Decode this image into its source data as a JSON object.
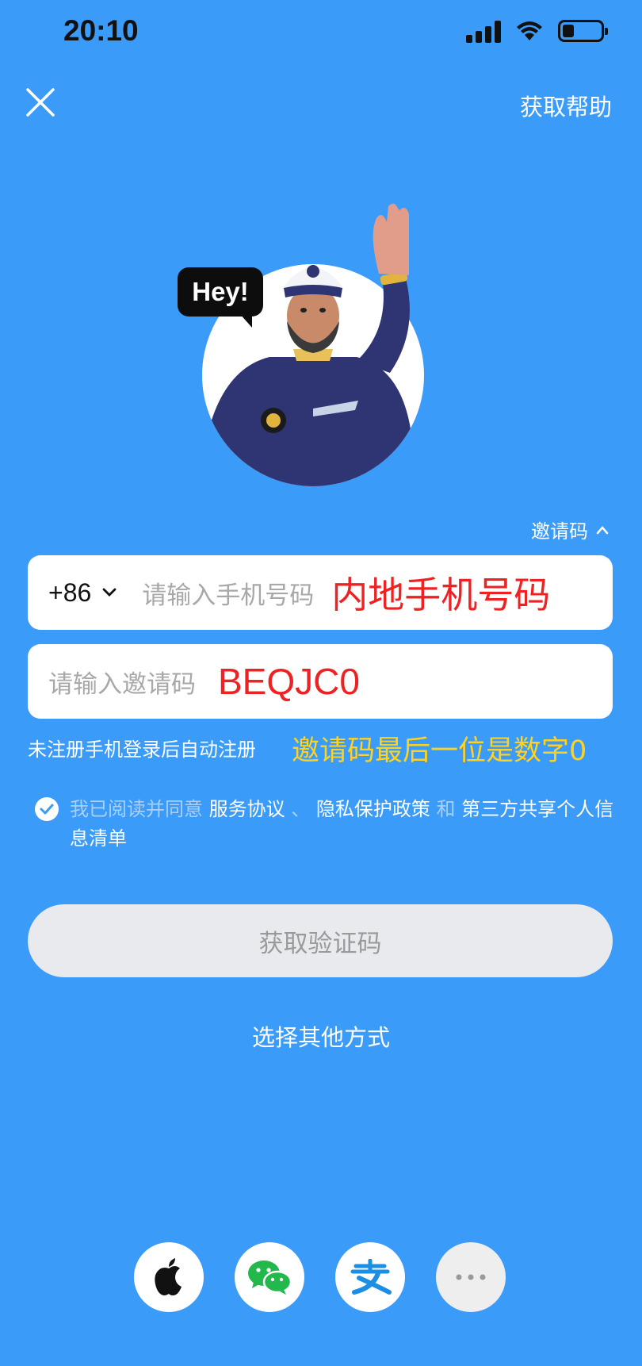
{
  "status_bar": {
    "time": "20:10"
  },
  "header": {
    "help_label": "获取帮助"
  },
  "hero": {
    "speech_text": "Hey!"
  },
  "invite_toggle": {
    "label": "邀请码"
  },
  "phone_field": {
    "country_code": "+86",
    "placeholder": "请输入手机号码",
    "overlay_note": "内地手机号码"
  },
  "invite_field": {
    "placeholder": "请输入邀请码",
    "overlay_code": "BEQJC0"
  },
  "auto_register_hint": "未注册手机登录后自动注册",
  "invite_note": "邀请码最后一位是数字0",
  "agreement": {
    "prefix": "我已阅读并同意 ",
    "terms": "服务协议",
    "sep1": " 、 ",
    "privacy": "隐私保护政策",
    "and": " 和 ",
    "third_party": "第三方共享个人信息清单"
  },
  "get_code_button": "获取验证码",
  "other_methods": "选择其他方式",
  "social_logins": [
    {
      "icon": "apple-icon"
    },
    {
      "icon": "wechat-icon"
    },
    {
      "icon": "alipay-icon"
    },
    {
      "icon": "more-icon"
    }
  ],
  "colors": {
    "background": "#3B9BF9",
    "note_red": "#EE2222",
    "note_yellow": "#FFD21F",
    "button_disabled": "#E8EAEE"
  }
}
